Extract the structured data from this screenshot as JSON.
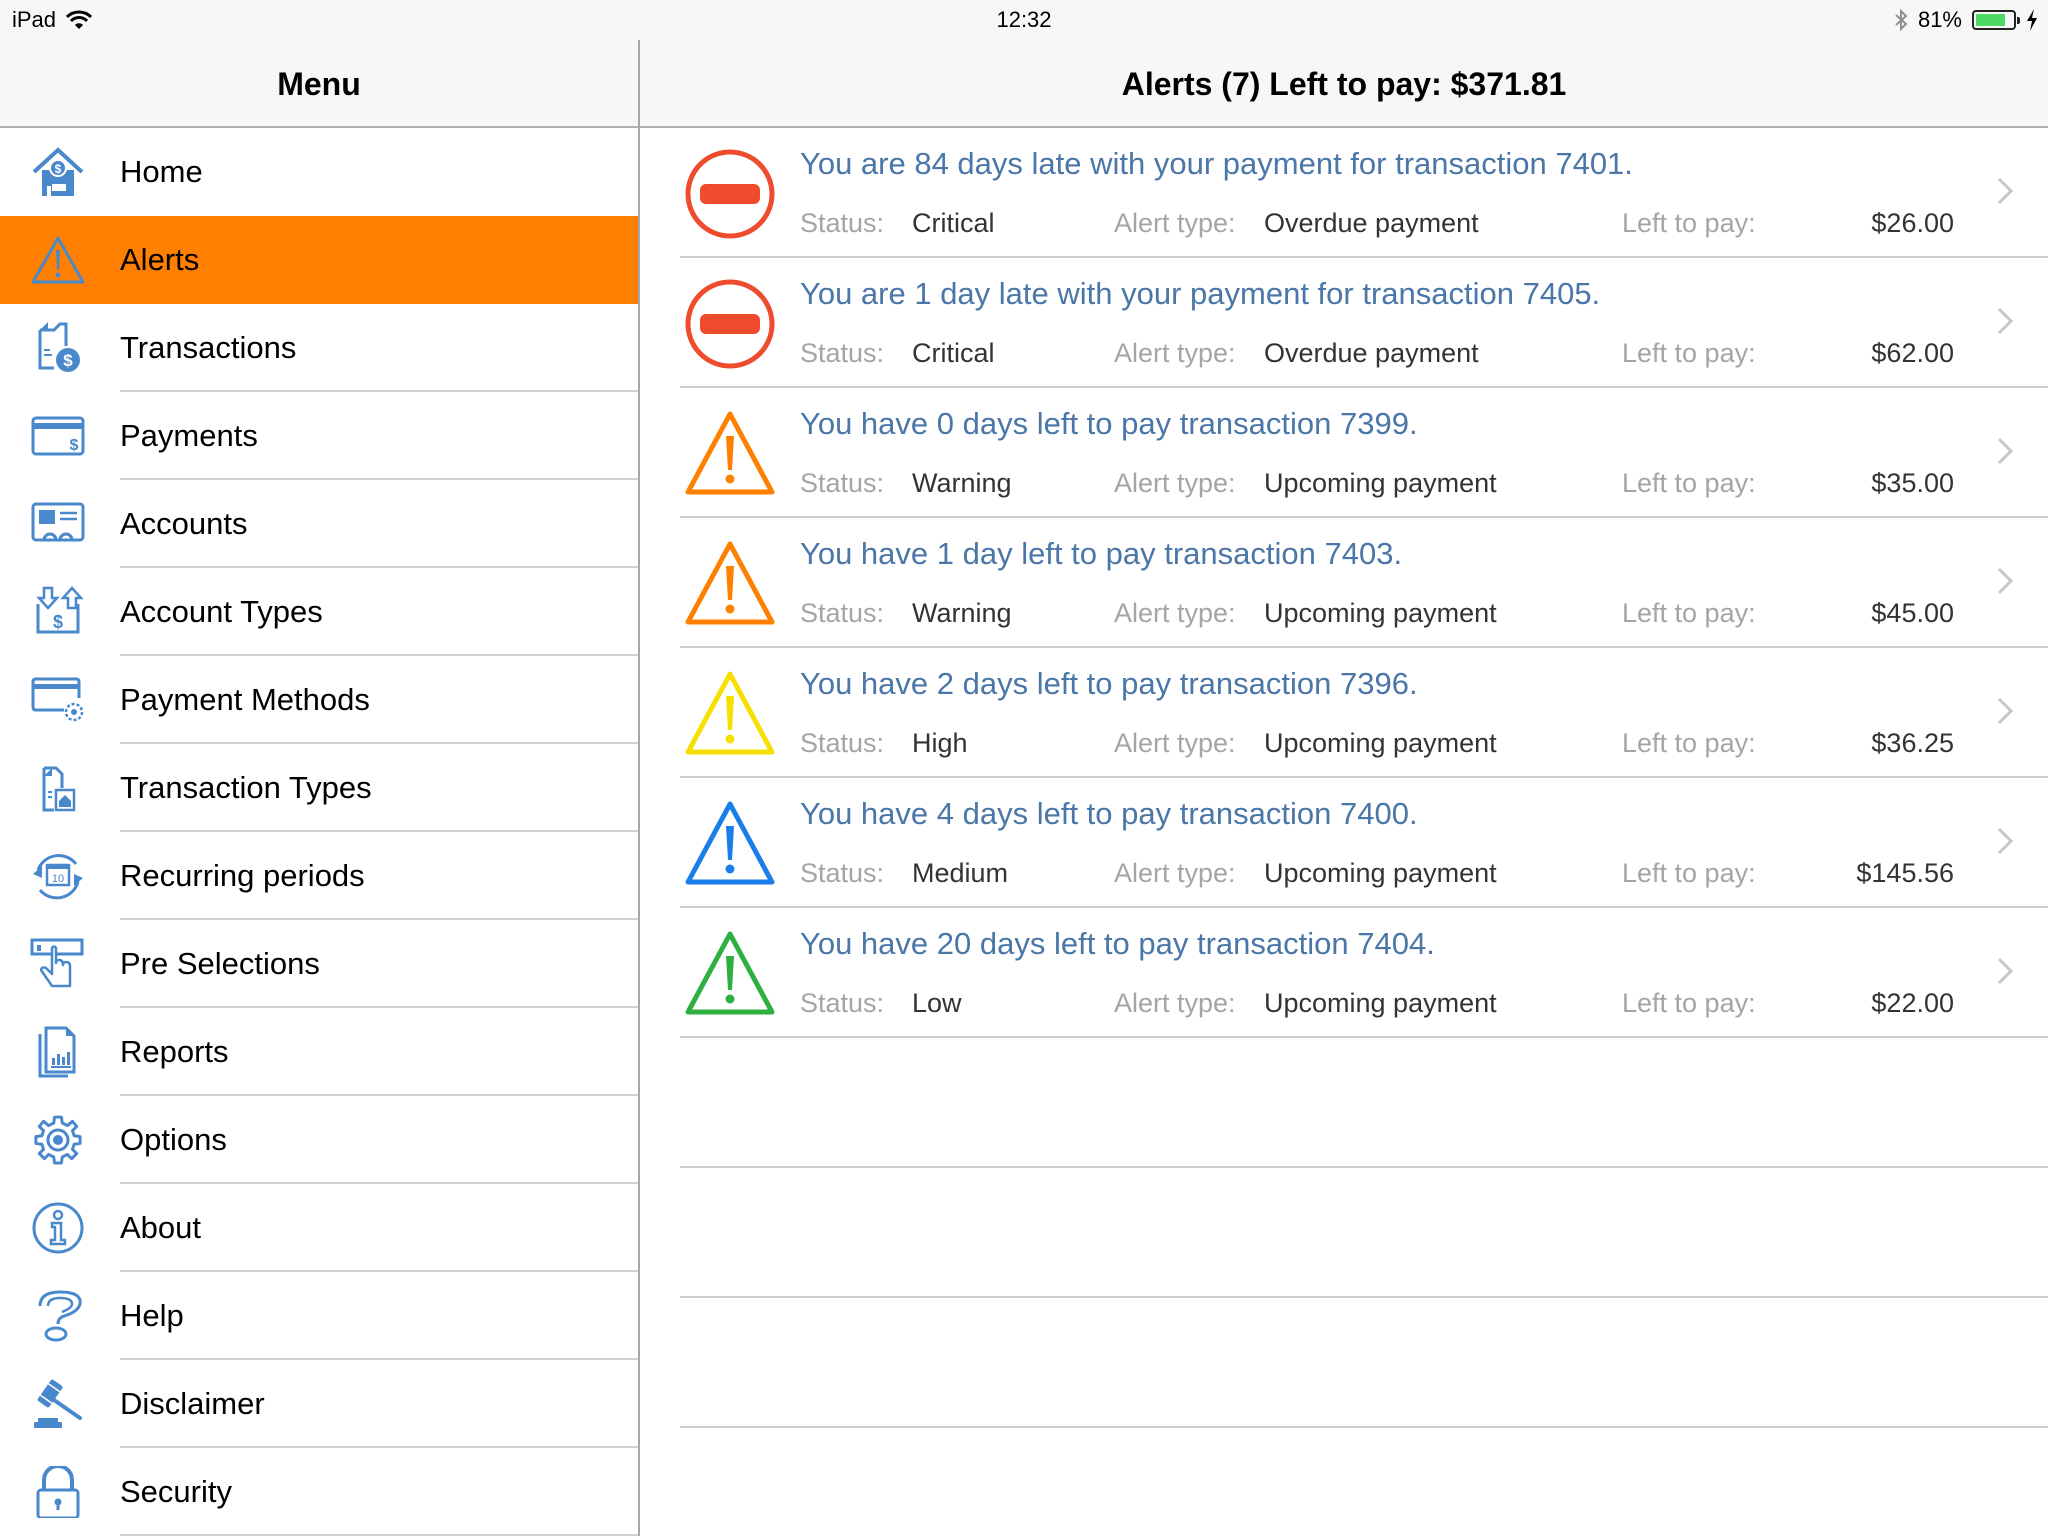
{
  "status_bar": {
    "device": "iPad",
    "time": "12:32",
    "battery_percent_label": "81%",
    "battery_level": 0.81,
    "icons": [
      "wifi-icon",
      "bluetooth-icon",
      "battery-icon",
      "charging-bolt-icon"
    ]
  },
  "sidebar": {
    "title": "Menu",
    "active_item": "Alerts",
    "active_color": "#ff8000",
    "icon_color": "#4a88cc",
    "items": [
      {
        "label": "Home",
        "icon": "home-dollar-icon"
      },
      {
        "label": "Alerts",
        "icon": "warning-triangle-icon"
      },
      {
        "label": "Transactions",
        "icon": "document-dollar-icon"
      },
      {
        "label": "Payments",
        "icon": "card-dollar-icon"
      },
      {
        "label": "Accounts",
        "icon": "id-card-icon"
      },
      {
        "label": "Account Types",
        "icon": "transfer-arrows-dollar-icon"
      },
      {
        "label": "Payment Methods",
        "icon": "card-gear-icon"
      },
      {
        "label": "Transaction Types",
        "icon": "document-house-icon"
      },
      {
        "label": "Recurring periods",
        "icon": "calendar-cycle-icon"
      },
      {
        "label": "Pre Selections",
        "icon": "hand-pointer-icon"
      },
      {
        "label": "Reports",
        "icon": "report-chart-icon"
      },
      {
        "label": "Options",
        "icon": "gear-icon"
      },
      {
        "label": "About",
        "icon": "info-icon"
      },
      {
        "label": "Help",
        "icon": "question-icon"
      },
      {
        "label": "Disclaimer",
        "icon": "gavel-icon"
      },
      {
        "label": "Security",
        "icon": "padlock-icon"
      }
    ]
  },
  "main": {
    "title": "Alerts (7) Left to pay: $371.81",
    "labels": {
      "status": "Status:",
      "alert_type": "Alert type:",
      "left_to_pay": "Left to pay:"
    },
    "alerts": [
      {
        "message": "You are 84 days late with your payment for transaction 7401.",
        "status": "Critical",
        "alert_type": "Overdue payment",
        "left_to_pay": "$26.00",
        "icon": "critical-minus-icon",
        "color": "#ee4c2c"
      },
      {
        "message": "You are 1 day late with your payment for transaction 7405.",
        "status": "Critical",
        "alert_type": "Overdue payment",
        "left_to_pay": "$62.00",
        "icon": "critical-minus-icon",
        "color": "#ee4c2c"
      },
      {
        "message": "You have 0 days left to pay transaction 7399.",
        "status": "Warning",
        "alert_type": "Upcoming payment",
        "left_to_pay": "$35.00",
        "icon": "warning-triangle-icon",
        "color": "#ff8000"
      },
      {
        "message": "You have 1 day left to pay transaction 7403.",
        "status": "Warning",
        "alert_type": "Upcoming payment",
        "left_to_pay": "$45.00",
        "icon": "warning-triangle-icon",
        "color": "#ff8000"
      },
      {
        "message": "You have 2 days left to pay transaction 7396.",
        "status": "High",
        "alert_type": "Upcoming payment",
        "left_to_pay": "$36.25",
        "icon": "warning-triangle-icon",
        "color": "#f5e000"
      },
      {
        "message": "You have 4 days left to pay transaction 7400.",
        "status": "Medium",
        "alert_type": "Upcoming payment",
        "left_to_pay": "$145.56",
        "icon": "warning-triangle-icon",
        "color": "#1a7ee8"
      },
      {
        "message": "You have 20 days left to pay transaction 7404.",
        "status": "Low",
        "alert_type": "Upcoming payment",
        "left_to_pay": "$22.00",
        "icon": "warning-triangle-icon",
        "color": "#2eaf3f"
      }
    ]
  }
}
